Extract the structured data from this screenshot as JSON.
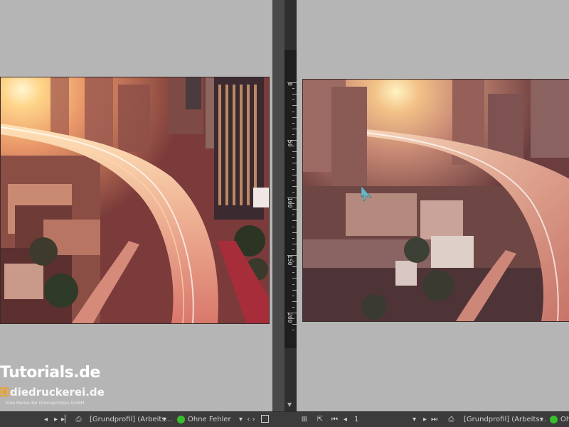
{
  "left_pane": {
    "branding": {
      "line1": "Tutorials.de",
      "line2": "diedruckerei.de",
      "line3": "Eine Marke der Onlineprinters GmbH"
    }
  },
  "ruler": {
    "labels": [
      "0",
      "50",
      "100",
      "150",
      "200"
    ]
  },
  "status_left": {
    "profile_label": "[Grundprofil] (Arbeits...",
    "preflight_status": "Ohne Fehler"
  },
  "status_right": {
    "page_number": "1",
    "profile_label": "[Grundprofil] (Arbeits...",
    "preflight_status": "Oh"
  },
  "colors": {
    "pane_bg": "#b5b5b5",
    "statusbar_bg": "#3c3c3c",
    "status_ok": "#38c02c"
  }
}
